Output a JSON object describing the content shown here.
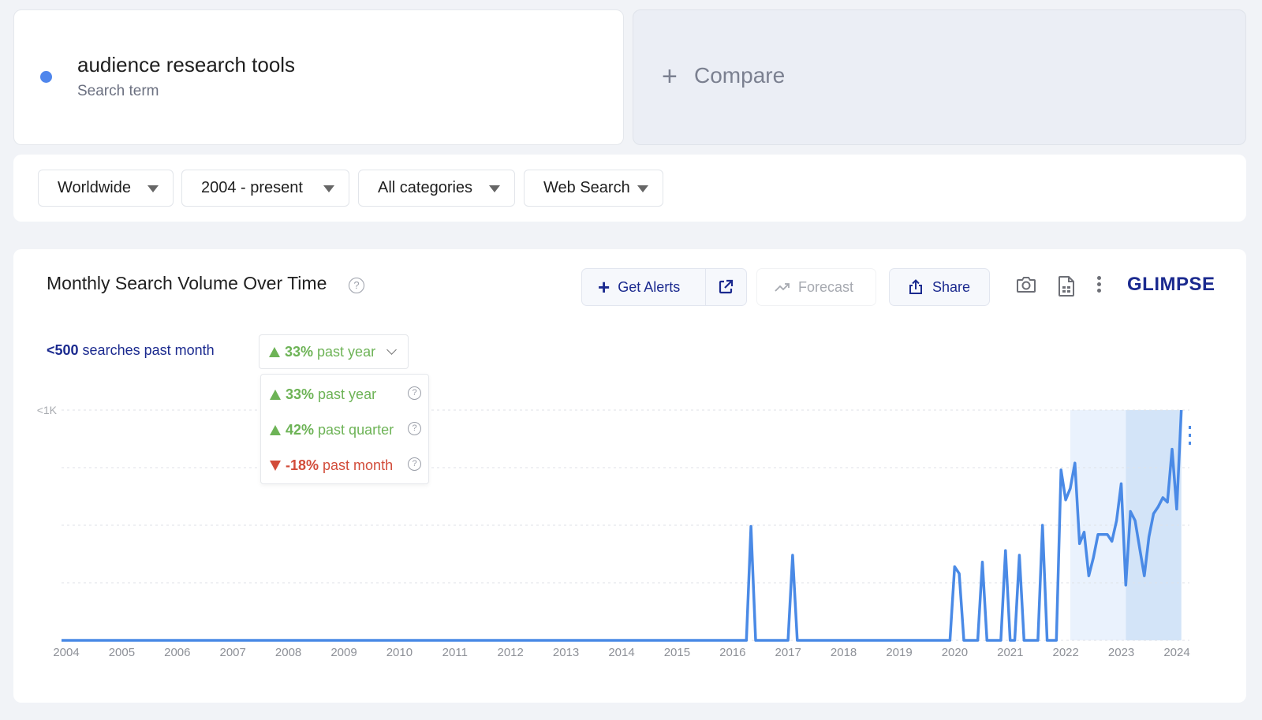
{
  "term": {
    "name": "audience research tools",
    "sublabel": "Search term",
    "color": "#4f86ec"
  },
  "compare": {
    "plus": "+",
    "label": "Compare"
  },
  "filters": [
    {
      "label": "Worldwide"
    },
    {
      "label": "2004 - present"
    },
    {
      "label": "All categories"
    },
    {
      "label": "Web Search"
    }
  ],
  "toolbar": {
    "title": "Monthly Search Volume Over Time",
    "help_glyph": "?",
    "alerts_label": "Get Alerts",
    "forecast_label": "Forecast",
    "share_label": "Share",
    "logo": "GLIMPSE"
  },
  "volume": {
    "value": "<500",
    "suffix": " searches past month"
  },
  "growth_select": {
    "value": "33%",
    "label": " past year",
    "direction": "up"
  },
  "growth_menu": [
    {
      "value": "33%",
      "label": " past year",
      "direction": "up"
    },
    {
      "value": "42%",
      "label": " past quarter",
      "direction": "up"
    },
    {
      "value": "-18%",
      "label": " past month",
      "direction": "down"
    }
  ],
  "colors": {
    "accent": "#1b2a8f",
    "line": "#4a8ae6",
    "up": "#6db356",
    "down": "#d24c3a",
    "shade_light": "#eaf2fd",
    "shade_dark": "#d3e4f8"
  },
  "chart_data": {
    "type": "line",
    "title": "Monthly Search Volume Over Time",
    "xlabel": "",
    "ylabel": "",
    "x_ticks": [
      "2004",
      "2005",
      "2006",
      "2007",
      "2008",
      "2009",
      "2010",
      "2011",
      "2012",
      "2013",
      "2014",
      "2015",
      "2016",
      "2017",
      "2018",
      "2019",
      "2020",
      "2021",
      "2022",
      "2023",
      "2024"
    ],
    "y_ticks": [
      {
        "value": 1000,
        "label": "<1K"
      }
    ],
    "ylim": [
      0,
      1000
    ],
    "x_range": [
      "2004-01",
      "2024-03"
    ],
    "grid": true,
    "shaded_periods": [
      {
        "from": "2022-03",
        "to": "2023-03",
        "shade": "light"
      },
      {
        "from": "2023-03",
        "to": "2024-03",
        "shade": "dark"
      }
    ],
    "series": [
      {
        "name": "audience research tools",
        "note": "monthly searches; months not listed are 0",
        "points": [
          [
            "2016-05",
            0
          ],
          [
            "2016-06",
            495
          ],
          [
            "2016-07",
            0
          ],
          [
            "2017-02",
            0
          ],
          [
            "2017-03",
            370
          ],
          [
            "2017-04",
            0
          ],
          [
            "2020-01",
            0
          ],
          [
            "2020-02",
            320
          ],
          [
            "2020-03",
            290
          ],
          [
            "2020-04",
            0
          ],
          [
            "2020-07",
            0
          ],
          [
            "2020-08",
            340
          ],
          [
            "2020-09",
            0
          ],
          [
            "2020-12",
            0
          ],
          [
            "2021-01",
            390
          ],
          [
            "2021-02",
            0
          ],
          [
            "2021-03",
            0
          ],
          [
            "2021-04",
            370
          ],
          [
            "2021-05",
            0
          ],
          [
            "2021-08",
            0
          ],
          [
            "2021-09",
            500
          ],
          [
            "2021-10",
            0
          ],
          [
            "2021-11",
            0
          ],
          [
            "2022-01",
            740
          ],
          [
            "2022-02",
            610
          ],
          [
            "2022-03",
            660
          ],
          [
            "2022-04",
            770
          ],
          [
            "2022-05",
            420
          ],
          [
            "2022-06",
            470
          ],
          [
            "2022-07",
            280
          ],
          [
            "2022-08",
            360
          ],
          [
            "2022-09",
            460
          ],
          [
            "2022-10",
            460
          ],
          [
            "2022-11",
            460
          ],
          [
            "2022-12",
            430
          ],
          [
            "2023-01",
            520
          ],
          [
            "2023-02",
            680
          ],
          [
            "2023-03",
            240
          ],
          [
            "2023-04",
            560
          ],
          [
            "2023-05",
            520
          ],
          [
            "2023-06",
            400
          ],
          [
            "2023-07",
            280
          ],
          [
            "2023-08",
            450
          ],
          [
            "2023-09",
            550
          ],
          [
            "2023-10",
            580
          ],
          [
            "2023-11",
            620
          ],
          [
            "2023-12",
            600
          ],
          [
            "2024-01",
            830
          ],
          [
            "2024-02",
            570
          ],
          [
            "2024-03",
            1000
          ]
        ]
      }
    ]
  }
}
